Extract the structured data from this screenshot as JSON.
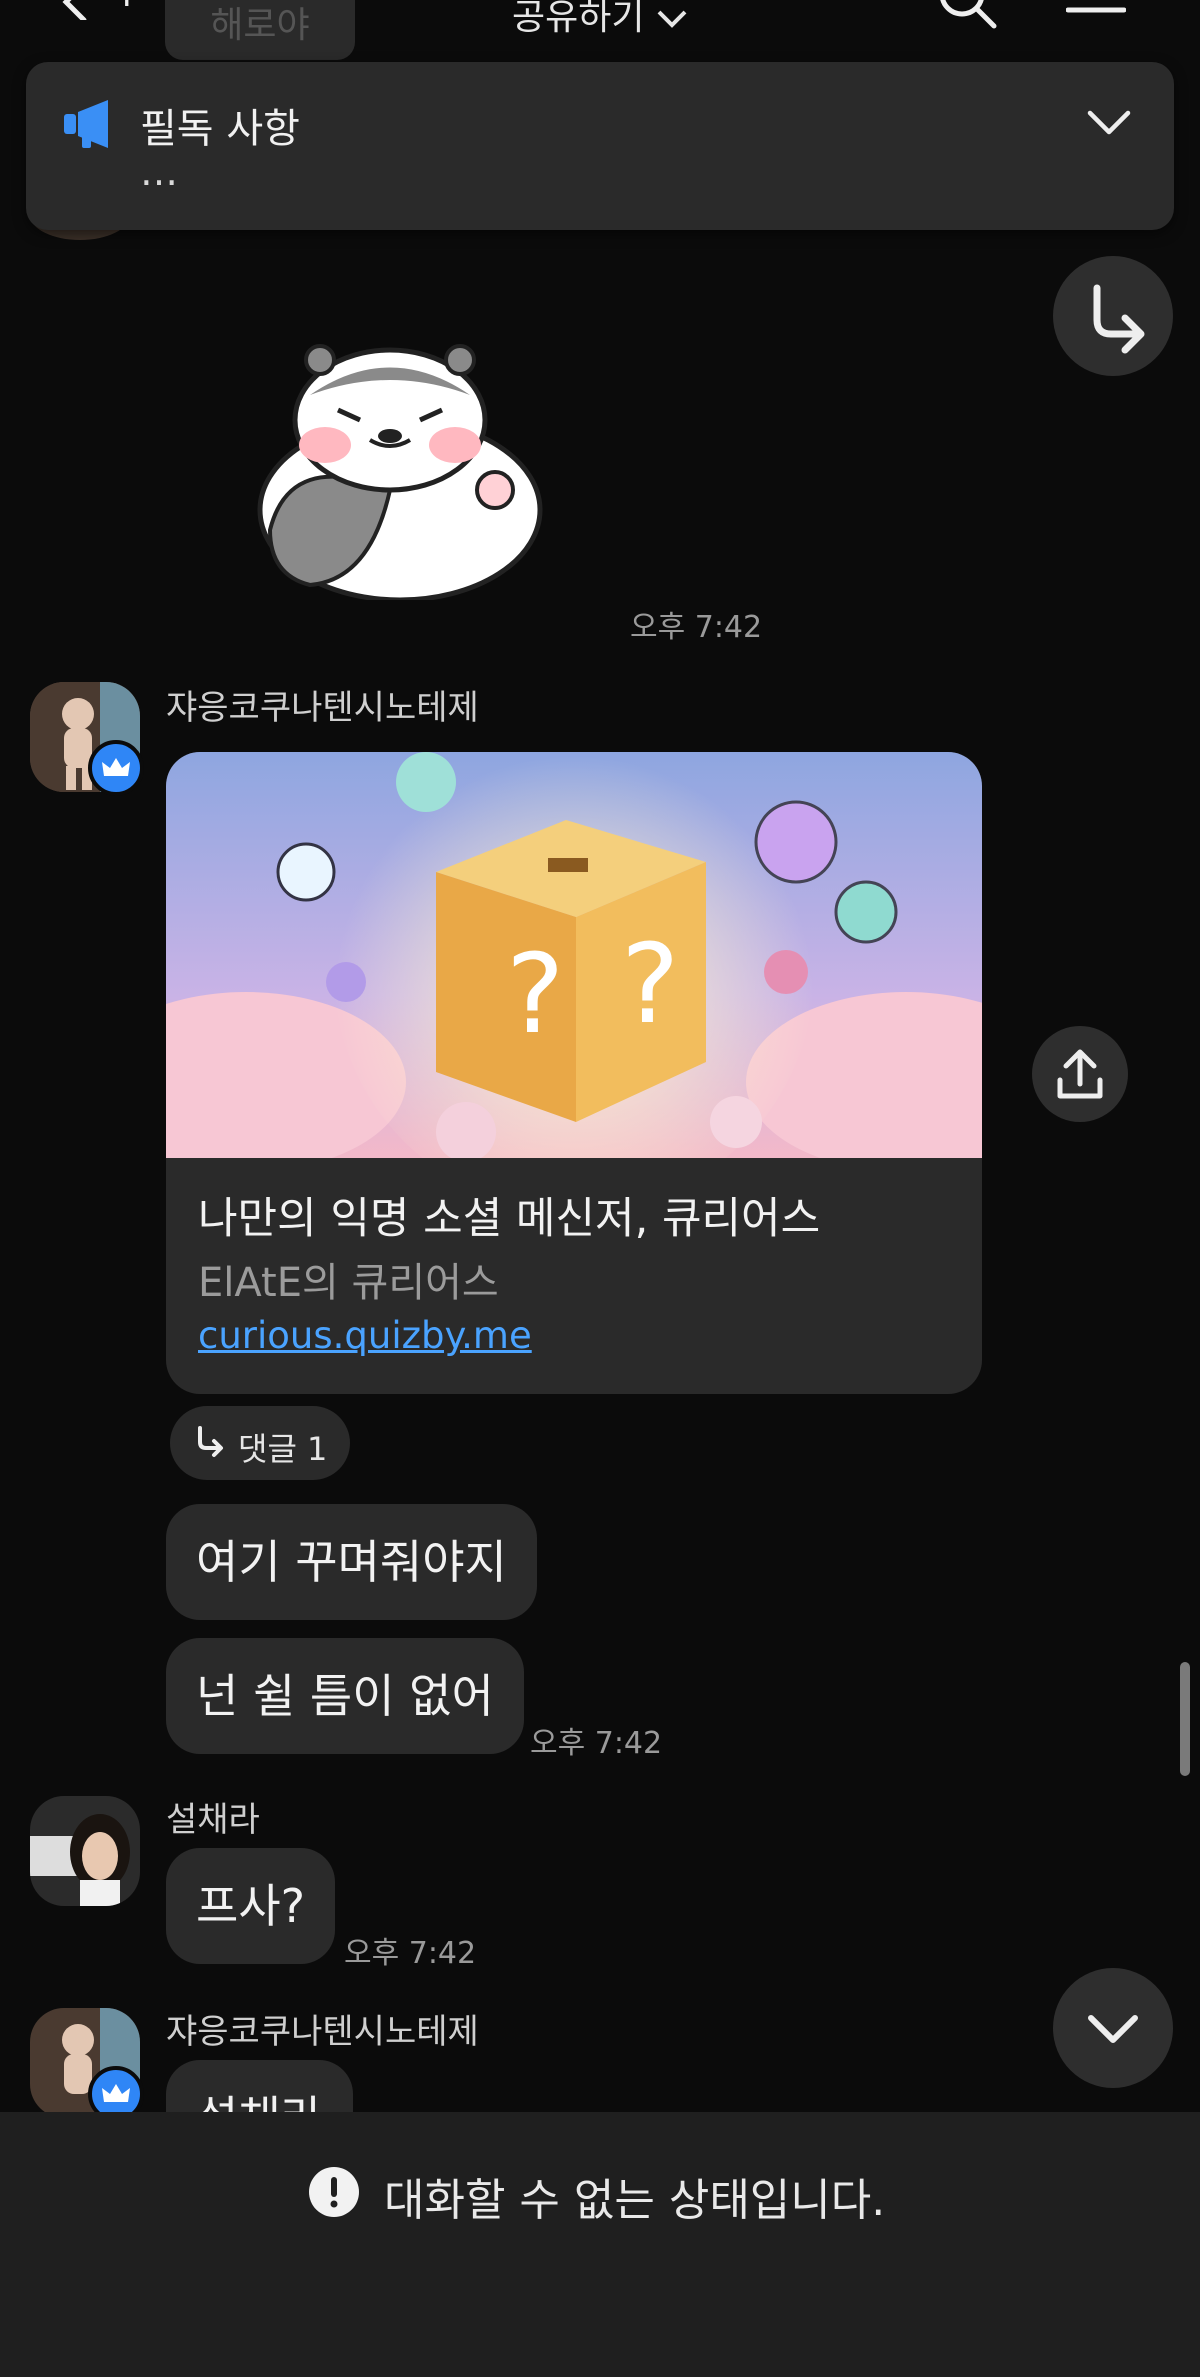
{
  "header": {
    "title": "공유하기",
    "clipped_name": "해로야",
    "plus_glyph": "+"
  },
  "pinned": {
    "title": "필독 사항",
    "subtitle": "…"
  },
  "messages": [
    {
      "time": "오후 7:42"
    },
    {
      "sender": "쟈응코쿠나텐시노테제",
      "card": {
        "title": "나만의 익명 소셜 메신저, 큐리어스",
        "subtitle": "ElAtE의 큐리어스",
        "link": "curious.quizby.me"
      },
      "reply_label": "댓글 1",
      "bubbles": [
        "여기 꾸며줘야지",
        "넌 쉴 틈이 없어"
      ],
      "time": "오후 7:42"
    },
    {
      "sender": "설채라",
      "bubbles": [
        "프사?"
      ],
      "time": "오후 7:42"
    },
    {
      "sender": "쟈응코쿠나텐시노테제",
      "bubbles": [
        "설채라"
      ]
    }
  ],
  "footer": {
    "notice": "대화할 수 없는 상태입니다."
  },
  "colors": {
    "background": "#0b0b0b",
    "bubble": "#2a2a2a",
    "accent_blue": "#2f86f6",
    "link": "#4aa3ff"
  },
  "icons": [
    "back-icon",
    "search-icon",
    "menu-icon",
    "megaphone-icon",
    "chevron-down-icon",
    "reply-arrow-icon",
    "share-icon",
    "warning-icon",
    "crown-icon"
  ]
}
